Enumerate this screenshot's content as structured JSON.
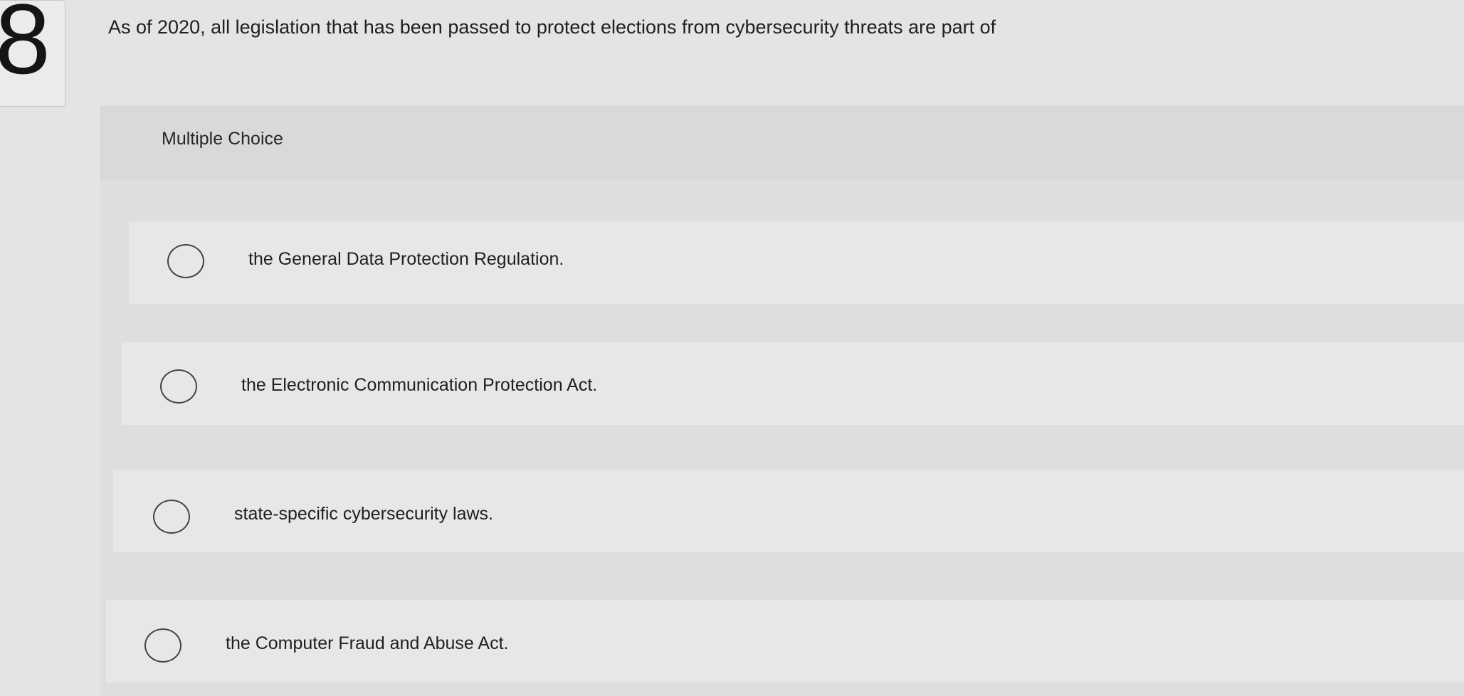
{
  "question": {
    "number": "8",
    "text": "As of 2020, all legislation that has been passed to protect elections from cybersecurity threats are part of"
  },
  "panel": {
    "label": "Multiple Choice"
  },
  "choices": [
    {
      "label": "the General Data Protection Regulation.",
      "selected": false
    },
    {
      "label": "the Electronic Communication Protection Act.",
      "selected": false
    },
    {
      "label": "state-specific cybersecurity laws.",
      "selected": false
    },
    {
      "label": "the Computer Fraud and Abuse Act.",
      "selected": false
    }
  ]
}
